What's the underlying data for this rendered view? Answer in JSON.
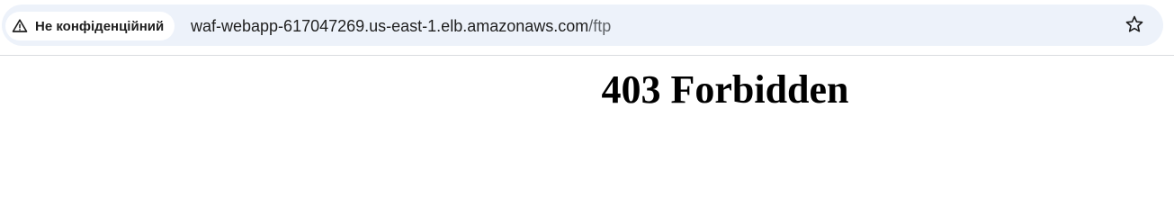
{
  "browser": {
    "security_chip": {
      "label": "Не конфіденційний",
      "icon": "warning-triangle-icon"
    },
    "address_bar": {
      "host": "waf-webapp-617047269.us-east-1.elb.amazonaws.com",
      "path": "/ftp"
    },
    "bookmark_icon": "star-icon"
  },
  "page": {
    "heading": "403 Forbidden"
  },
  "colors": {
    "omnibox_bg": "#edf2fa",
    "chip_bg": "#ffffff",
    "text": "#1f1f1f",
    "path_text": "#5f6368"
  }
}
